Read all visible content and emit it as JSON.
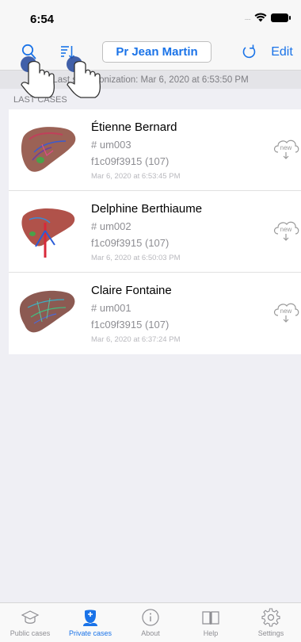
{
  "status_bar": {
    "time": "6:54",
    "signal": "....."
  },
  "nav": {
    "doctor_label": "Pr Jean Martin",
    "edit_label": "Edit"
  },
  "sync_text": "Last synchronization: Mar 6, 2020 at 6:53:50 PM",
  "section_header": "LAST CASES",
  "cases": [
    {
      "name": "Étienne Bernard",
      "id": "# um003",
      "hash": "f1c09f3915 (107)",
      "date": "Mar 6, 2020 at 6:53:45 PM",
      "badge": "new"
    },
    {
      "name": "Delphine Berthiaume",
      "id": "# um002",
      "hash": "f1c09f3915 (107)",
      "date": "Mar 6, 2020 at 6:50:03 PM",
      "badge": "new"
    },
    {
      "name": "Claire Fontaine",
      "id": "# um001",
      "hash": "f1c09f3915 (107)",
      "date": "Mar 6, 2020 at 6:37:24 PM",
      "badge": "new"
    }
  ],
  "tabs": [
    {
      "label": "Public cases",
      "icon": "graduation-cap-icon",
      "active": false
    },
    {
      "label": "Private cases",
      "icon": "doctor-icon",
      "active": true
    },
    {
      "label": "About",
      "icon": "info-icon",
      "active": false
    },
    {
      "label": "Help",
      "icon": "book-icon",
      "active": false
    },
    {
      "label": "Settings",
      "icon": "gear-icon",
      "active": false
    }
  ],
  "colors": {
    "accent": "#1a73e8",
    "background": "#efeff4",
    "secondary_text": "#8e8e93"
  }
}
